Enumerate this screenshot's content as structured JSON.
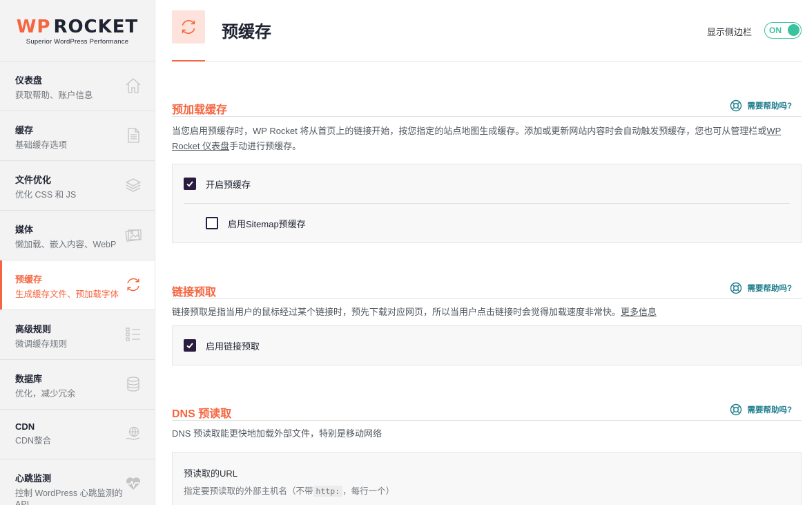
{
  "logo": {
    "brand_wp": "WP",
    "brand_rest": "ROCKET",
    "tagline": "Superior WordPress Performance"
  },
  "sidebar": {
    "items": [
      {
        "title": "仪表盘",
        "desc": "获取帮助、账户信息",
        "icon": "home-icon"
      },
      {
        "title": "缓存",
        "desc": "基础缓存选项",
        "icon": "document-icon"
      },
      {
        "title": "文件优化",
        "desc": "优化 CSS 和 JS",
        "icon": "layers-icon"
      },
      {
        "title": "媒体",
        "desc": "懒加载、嵌入内容、WebP",
        "icon": "images-icon"
      },
      {
        "title": "预缓存",
        "desc": "生成缓存文件、预加载字体",
        "icon": "refresh-icon",
        "active": true
      },
      {
        "title": "高级规则",
        "desc": "微调缓存规则",
        "icon": "list-icon"
      },
      {
        "title": "数据库",
        "desc": "优化，减少冗余",
        "icon": "database-icon"
      },
      {
        "title": "CDN",
        "desc": "CDN整合",
        "icon": "cdn-icon"
      },
      {
        "title": "心跳监测",
        "desc": "控制 WordPress 心跳监测的 API",
        "icon": "heartbeat-icon"
      }
    ]
  },
  "header": {
    "title": "预缓存",
    "sidebar_toggle_label": "显示侧边栏",
    "toggle_state": "ON"
  },
  "sections": {
    "preload": {
      "title": "预加载缓存",
      "help": "需要帮助吗?",
      "desc_before_link": "当您启用预缓存时，WP Rocket 将从首页上的链接开始，按您指定的站点地图生成缓存。添加或更新网站内容时会自动触发预缓存，您也可从管理栏或",
      "desc_link": "WP Rocket 仪表盘",
      "desc_after_link": "手动进行预缓存。",
      "option_enable": "开启预缓存",
      "option_enable_checked": true,
      "option_sitemap": "启用Sitemap预缓存",
      "option_sitemap_checked": false
    },
    "link_prefetch": {
      "title": "链接预取",
      "help": "需要帮助吗?",
      "desc": "链接预取是指当用户的鼠标经过某个链接时，预先下载对应网页，所以当用户点击链接时会觉得加载速度非常快。",
      "more_link": "更多信息",
      "option_enable": "启用链接预取",
      "option_enable_checked": true
    },
    "dns": {
      "title": "DNS 预读取",
      "help": "需要帮助吗?",
      "desc": "DNS 预读取能更快地加载外部文件，特别是移动网络",
      "url_title": "预读取的URL",
      "url_desc_before": "指定要预读取的外部主机名（不带",
      "url_desc_code": "http:",
      "url_desc_after": "，每行一个）"
    }
  },
  "colors": {
    "accent": "#f56640",
    "teal": "#1d7d8c",
    "toggle_green": "#3ac39e",
    "checkbox": "#2a1c3e"
  }
}
